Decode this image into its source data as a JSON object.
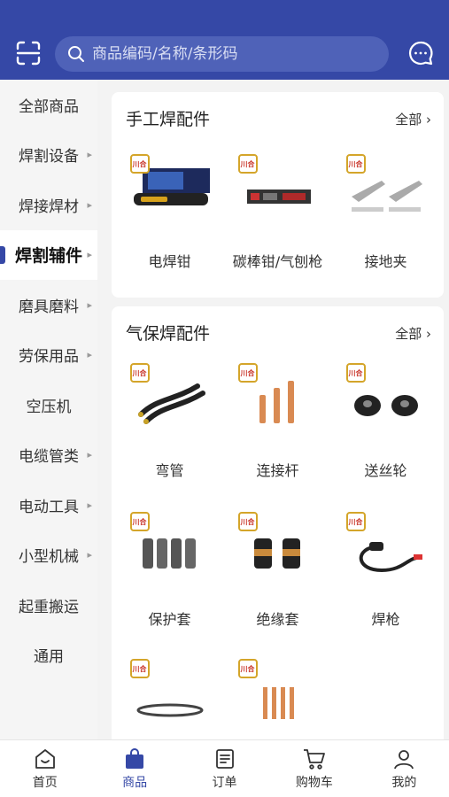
{
  "search": {
    "placeholder": "商品编码/名称/条形码"
  },
  "sidebar": {
    "items": [
      {
        "label": "全部商品",
        "arrow": false
      },
      {
        "label": "焊割设备",
        "arrow": true
      },
      {
        "label": "焊接焊材",
        "arrow": true
      },
      {
        "label": "焊割辅件",
        "arrow": true,
        "active": true
      },
      {
        "label": "磨具磨料",
        "arrow": true
      },
      {
        "label": "劳保用品",
        "arrow": true
      },
      {
        "label": "空压机",
        "arrow": false
      },
      {
        "label": "电缆管类",
        "arrow": true
      },
      {
        "label": "电动工具",
        "arrow": true
      },
      {
        "label": "小型机械",
        "arrow": true
      },
      {
        "label": "起重搬运",
        "arrow": false
      },
      {
        "label": "通用",
        "arrow": false
      }
    ]
  },
  "sections": [
    {
      "title": "手工焊配件",
      "all_label": "全部",
      "items": [
        {
          "label": "电焊钳"
        },
        {
          "label": "碳棒钳/气刨枪"
        },
        {
          "label": "接地夹"
        }
      ]
    },
    {
      "title": "气保焊配件",
      "all_label": "全部",
      "items": [
        {
          "label": "弯管"
        },
        {
          "label": "连接杆"
        },
        {
          "label": "送丝轮"
        },
        {
          "label": "保护套"
        },
        {
          "label": "绝缘套"
        },
        {
          "label": "焊枪"
        },
        {
          "label": ""
        },
        {
          "label": ""
        }
      ]
    }
  ],
  "product_logo_text": "川合",
  "bottom_nav": [
    {
      "label": "首页",
      "icon": "home-icon"
    },
    {
      "label": "商品",
      "icon": "bag-icon",
      "active": true
    },
    {
      "label": "订单",
      "icon": "order-icon"
    },
    {
      "label": "购物车",
      "icon": "cart-icon"
    },
    {
      "label": "我的",
      "icon": "user-icon"
    }
  ],
  "colors": {
    "accent": "#3548a6",
    "header": "#3548a6",
    "search_bg": "#4f62b8"
  }
}
